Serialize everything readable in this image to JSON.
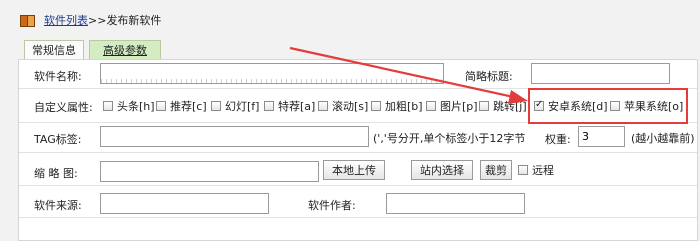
{
  "breadcrumb": {
    "link": "软件列表",
    "separator": ">>",
    "current": "发布新软件"
  },
  "tabs": [
    {
      "label": "常规信息",
      "active": false
    },
    {
      "label": "高级参数",
      "active": true
    }
  ],
  "form": {
    "name_label": "软件名称:",
    "short_title_label": "简略标题:",
    "custom_attr_label": "自定义属性:",
    "attributes": [
      {
        "label": "头条[h]",
        "checked": false
      },
      {
        "label": "推荐[c]",
        "checked": false
      },
      {
        "label": "幻灯[f]",
        "checked": false
      },
      {
        "label": "特荐[a]",
        "checked": false
      },
      {
        "label": "滚动[s]",
        "checked": false
      },
      {
        "label": "加粗[b]",
        "checked": false
      },
      {
        "label": "图片[p]",
        "checked": false
      },
      {
        "label": "跳转[j]",
        "checked": false
      },
      {
        "label": "安卓系统[d]",
        "checked": true
      },
      {
        "label": "苹果系统[o]",
        "checked": false
      }
    ],
    "tag_label": "TAG标签:",
    "tag_hint": "(','号分开,单个标签小于12字节",
    "weight_label": "权重:",
    "weight_value": "3",
    "weight_hint": "(越小越靠前)",
    "thumb_label": "缩 略 图:",
    "upload_button": "本地上传",
    "site_select_button": "站内选择",
    "crop_button": "裁剪",
    "remote_label": "远程",
    "source_label": "软件来源:",
    "author_label": "软件作者:"
  },
  "annotation_color": "#e43b3b"
}
